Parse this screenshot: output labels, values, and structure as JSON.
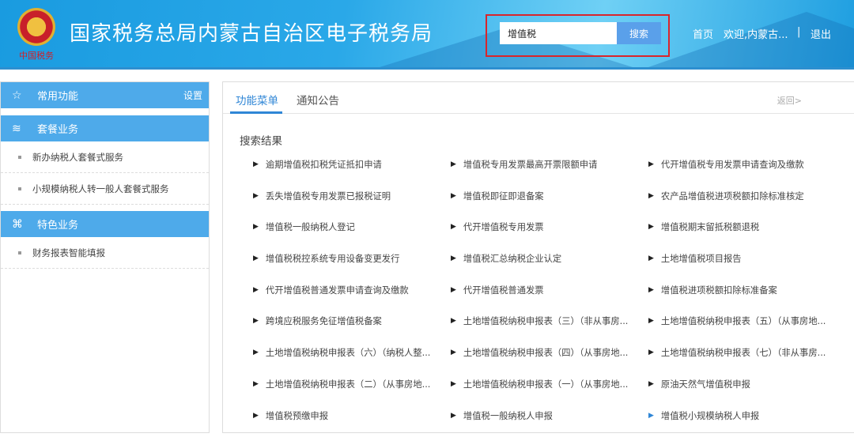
{
  "header": {
    "title": "国家税务总局内蒙古自治区电子税务局",
    "emblem_text": "中国税务",
    "search_value": "增值税",
    "search_button": "搜索",
    "nav_home": "首页",
    "nav_welcome": "欢迎,内蒙古...",
    "nav_sep": "|",
    "nav_logout": "退出"
  },
  "sidebar": {
    "common": {
      "label": "常用功能",
      "settings": "设置"
    },
    "package": {
      "label": "套餐业务",
      "items": [
        "新办纳税人套餐式服务",
        "小规模纳税人转一般人套餐式服务"
      ]
    },
    "special": {
      "label": "特色业务",
      "items": [
        "财务报表智能填报"
      ]
    }
  },
  "main": {
    "tabs": [
      "功能菜单",
      "通知公告"
    ],
    "back": "返回>",
    "results_title": "搜索结果",
    "results": [
      "逾期增值税扣税凭证抵扣申请",
      "增值税专用发票最高开票限额申请",
      "代开增值税专用发票申请查询及缴款",
      "丢失增值税专用发票已报税证明",
      "增值税即征即退备案",
      "农产品增值税进项税额扣除标准核定",
      "增值税一般纳税人登记",
      "代开增值税专用发票",
      "增值税期末留抵税额退税",
      "增值税税控系统专用设备变更发行",
      "增值税汇总纳税企业认定",
      "土地增值税项目报告",
      "代开增值税普通发票申请查询及缴款",
      "代开增值税普通发票",
      "增值税进项税额扣除标准备案",
      "跨境应税服务免征增值税备案",
      "土地增值税纳税申报表（三）（非从事房...",
      "土地增值税纳税申报表（五）（从事房地...",
      "土地增值税纳税申报表（六）（纳税人整...",
      "土地增值税纳税申报表（四）（从事房地...",
      "土地增值税纳税申报表（七）（非从事房...",
      "土地增值税纳税申报表（二）（从事房地...",
      "土地增值税纳税申报表（一）（从事房地...",
      "原油天然气增值税申报",
      "增值税预缴申报",
      "增值税一般纳税人申报",
      "增值税小规模纳税人申报"
    ]
  }
}
